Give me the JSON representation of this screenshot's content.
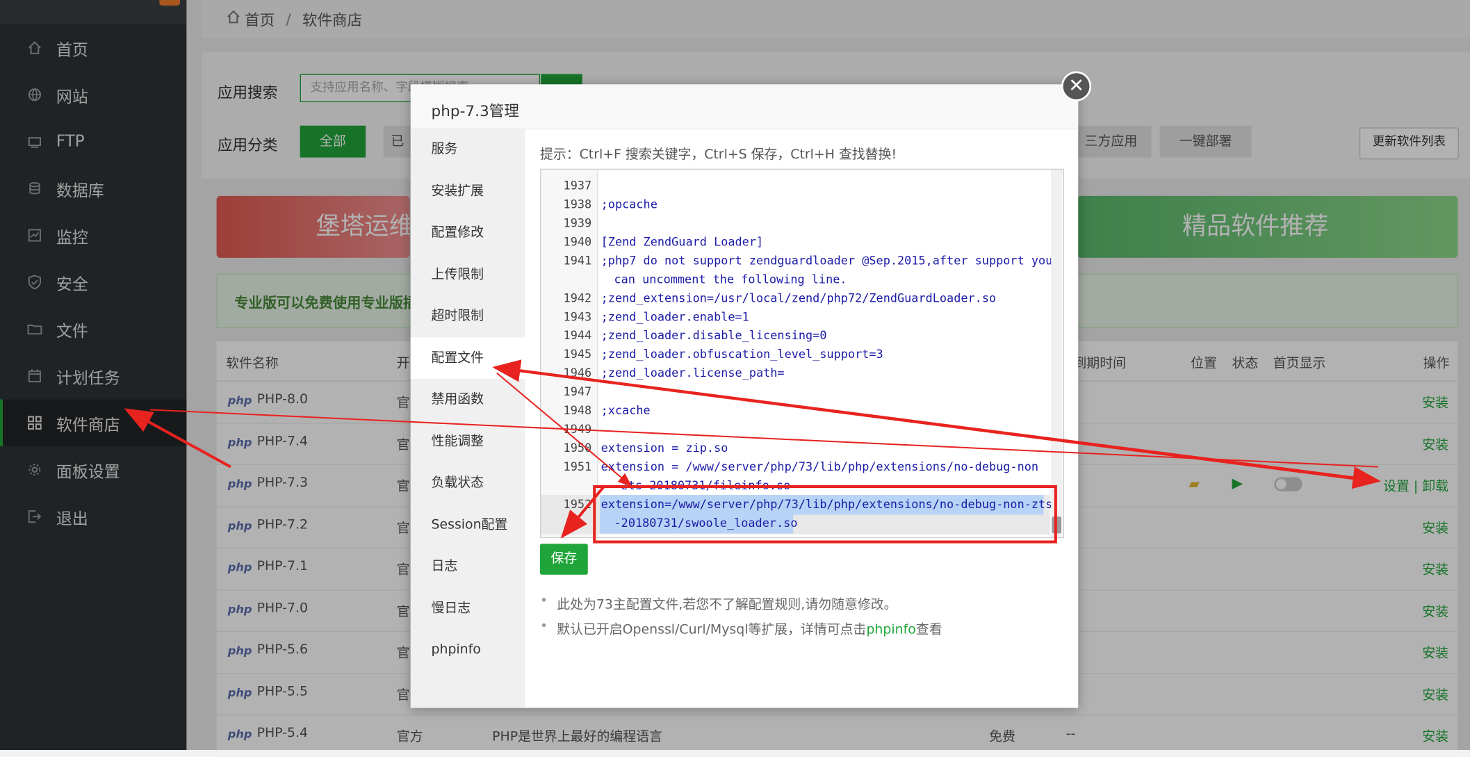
{
  "sidebar": {
    "items": [
      {
        "label": "首页",
        "icon": "home-icon"
      },
      {
        "label": "网站",
        "icon": "globe-icon"
      },
      {
        "label": "FTP",
        "icon": "ftp-icon"
      },
      {
        "label": "数据库",
        "icon": "database-icon"
      },
      {
        "label": "监控",
        "icon": "monitor-icon"
      },
      {
        "label": "安全",
        "icon": "shield-icon"
      },
      {
        "label": "文件",
        "icon": "folder-icon"
      },
      {
        "label": "计划任务",
        "icon": "calendar-icon"
      },
      {
        "label": "软件商店",
        "icon": "grid-icon"
      },
      {
        "label": "面板设置",
        "icon": "gear-icon"
      },
      {
        "label": "退出",
        "icon": "logout-icon"
      }
    ]
  },
  "breadcrumb": {
    "home": "首页",
    "sep": "/",
    "current": "软件商店"
  },
  "search": {
    "label": "应用搜索",
    "placeholder": "支持应用名称、字段模糊搜索"
  },
  "category": {
    "label": "应用分类",
    "all": "全部",
    "second": "已",
    "third_party": "三方应用",
    "one_click": "一键部署",
    "update_list": "更新软件列表"
  },
  "banners": {
    "red": "堡塔运维",
    "green": "精品软件推荐",
    "pro": "专业版可以免费使用专业版插"
  },
  "table": {
    "headers": {
      "name": "软件名称",
      "dev": "开",
      "expire": "到期时间",
      "location": "位置",
      "status": "状态",
      "home_display": "首页显示",
      "ops": "操作"
    },
    "rows": [
      {
        "logo": "php",
        "name": "PHP-8.0",
        "src": "官",
        "desc": "",
        "price": "",
        "expire": "",
        "action": "安装"
      },
      {
        "logo": "php",
        "name": "PHP-7.4",
        "src": "官",
        "desc": "",
        "price": "",
        "expire": "",
        "action": "安装"
      },
      {
        "logo": "php",
        "name": "PHP-7.3",
        "src": "官",
        "desc": "",
        "price": "",
        "expire": "",
        "action": "设置 | 卸载"
      },
      {
        "logo": "php",
        "name": "PHP-7.2",
        "src": "官",
        "desc": "",
        "price": "",
        "expire": "",
        "action": "安装"
      },
      {
        "logo": "php",
        "name": "PHP-7.1",
        "src": "官",
        "desc": "",
        "price": "",
        "expire": "",
        "action": "安装"
      },
      {
        "logo": "php",
        "name": "PHP-7.0",
        "src": "官",
        "desc": "",
        "price": "",
        "expire": "",
        "action": "安装"
      },
      {
        "logo": "php",
        "name": "PHP-5.6",
        "src": "官",
        "desc": "",
        "price": "",
        "expire": "",
        "action": "安装"
      },
      {
        "logo": "php",
        "name": "PHP-5.5",
        "src": "官",
        "desc": "",
        "price": "",
        "expire": "",
        "action": "安装"
      },
      {
        "logo": "php",
        "name": "PHP-5.4",
        "src": "官方",
        "desc": "PHP是世界上最好的编程语言",
        "price": "免费",
        "expire": "--",
        "action": "安装"
      }
    ]
  },
  "modal": {
    "title": "php-7.3管理",
    "nav": [
      "服务",
      "安装扩展",
      "配置修改",
      "上传限制",
      "超时限制",
      "配置文件",
      "禁用函数",
      "性能调整",
      "负载状态",
      "Session配置",
      "日志",
      "慢日志",
      "phpinfo"
    ],
    "hint": "提示：Ctrl+F 搜索关键字，Ctrl+S 保存，Ctrl+H 查找替换!",
    "code": [
      {
        "ln": "1937",
        "text": ""
      },
      {
        "ln": "1938",
        "text": ";opcache"
      },
      {
        "ln": "1939",
        "text": ""
      },
      {
        "ln": "1940",
        "text": "[Zend ZendGuard Loader]"
      },
      {
        "ln": "1941",
        "text": ";php7 do not support zendguardloader @Sep.2015,after support you"
      },
      {
        "ln": "",
        "text": "can uncomment the following line."
      },
      {
        "ln": "1942",
        "text": ";zend_extension=/usr/local/zend/php72/ZendGuardLoader.so"
      },
      {
        "ln": "1943",
        "text": ";zend_loader.enable=1"
      },
      {
        "ln": "1944",
        "text": ";zend_loader.disable_licensing=0"
      },
      {
        "ln": "1945",
        "text": ";zend_loader.obfuscation_level_support=3"
      },
      {
        "ln": "1946",
        "text": ";zend_loader.license_path="
      },
      {
        "ln": "1947",
        "text": ""
      },
      {
        "ln": "1948",
        "text": ";xcache"
      },
      {
        "ln": "1949",
        "text": ""
      },
      {
        "ln": "1950",
        "text": "extension = zip.so"
      },
      {
        "ln": "1951",
        "text": "extension = /www/server/php/73/lib/php/extensions/no-debug-non"
      },
      {
        "ln": "",
        "text": "-zts-20180731/fileinfo.so"
      },
      {
        "ln": "1952",
        "text": "extension=/www/server/php/73/lib/php/extensions/no-debug-non-zts"
      },
      {
        "ln": "",
        "text": "-20180731/swoole_loader.so"
      }
    ],
    "save": "保存",
    "note1": "此处为73主配置文件,若您不了解配置规则,请勿随意修改。",
    "note2_pre": "默认已开启Openssl/Curl/Mysql等扩展，详情可点击",
    "note2_link": "phpinfo",
    "note2_post": "查看"
  },
  "colors": {
    "accent": "#20a53a",
    "sidebar": "#2f3335",
    "annotation": "#e8231f"
  }
}
